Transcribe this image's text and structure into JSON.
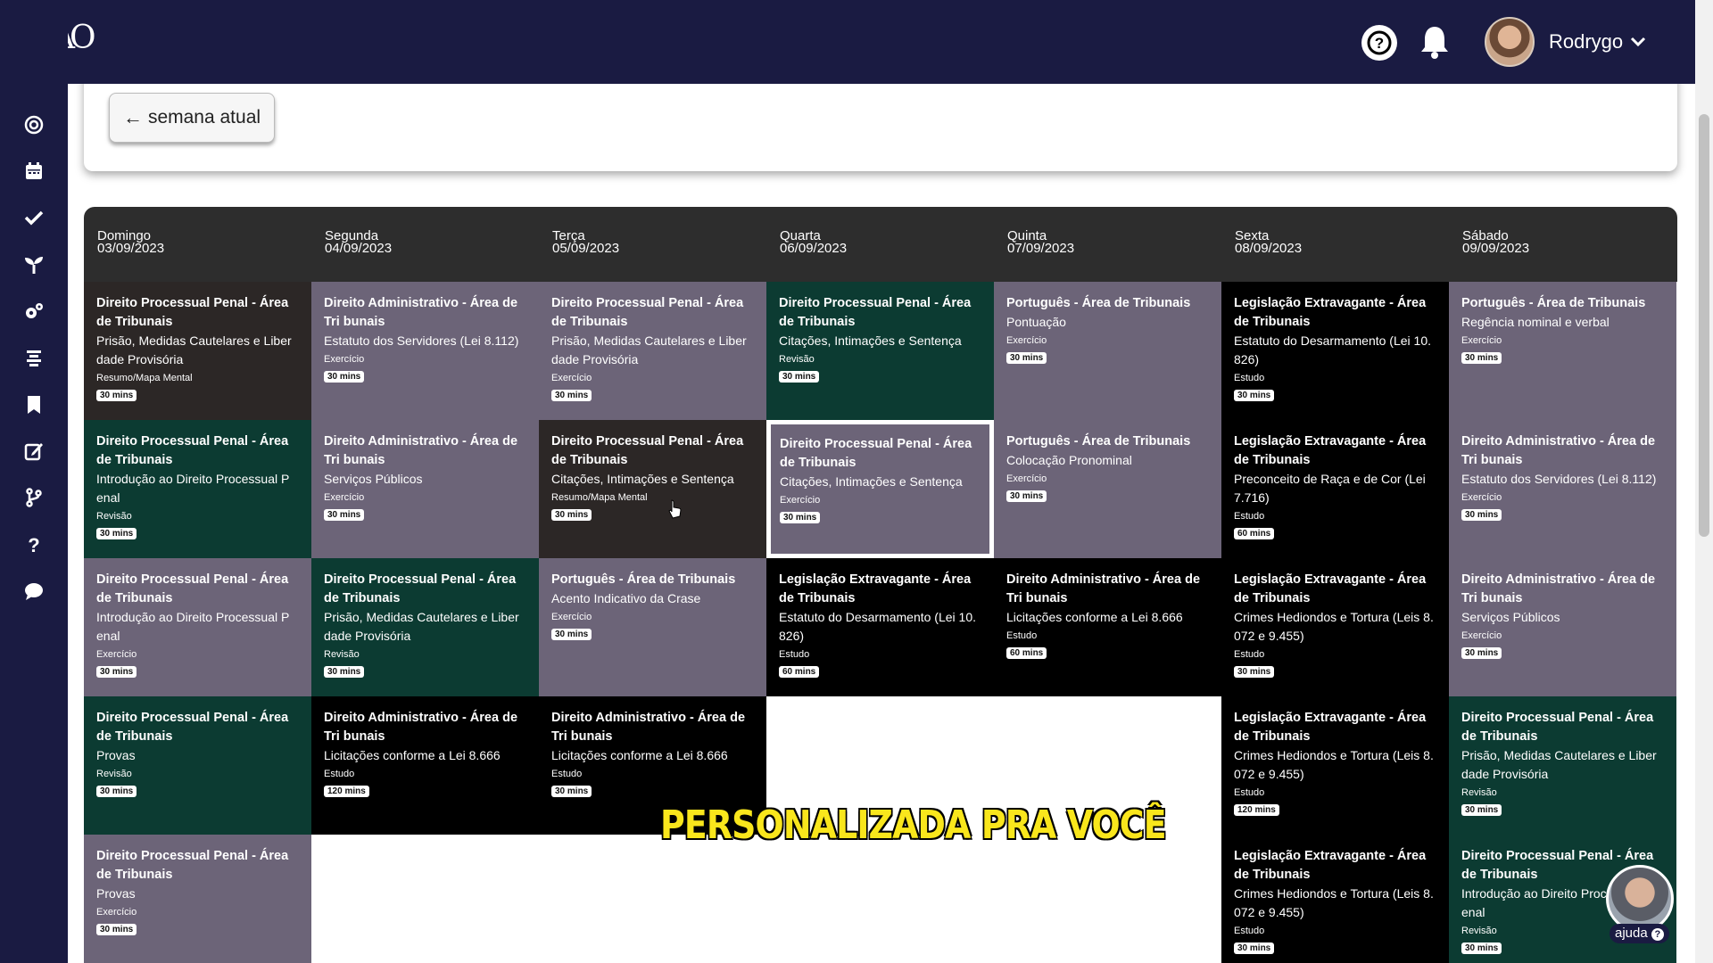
{
  "header": {
    "logo_text": "AO",
    "help_icon": "question-circle-icon",
    "bell_icon": "bell-icon",
    "user_name": "Rodrygo"
  },
  "sidebar": {
    "items": [
      {
        "icon": "target-icon"
      },
      {
        "icon": "calendar-icon"
      },
      {
        "icon": "check-icon"
      },
      {
        "icon": "sprout-icon"
      },
      {
        "icon": "gears-icon"
      },
      {
        "icon": "align-center-icon"
      },
      {
        "icon": "bookmark-icon"
      },
      {
        "icon": "edit-icon"
      },
      {
        "icon": "code-branch-icon"
      },
      {
        "icon": "question-icon"
      },
      {
        "icon": "chat-icon"
      }
    ]
  },
  "week_nav": {
    "back_label": "semana atual"
  },
  "calendar": {
    "days": [
      {
        "name": "Domingo",
        "date": "03/09/2023"
      },
      {
        "name": "Segunda",
        "date": "04/09/2023"
      },
      {
        "name": "Terça",
        "date": "05/09/2023"
      },
      {
        "name": "Quarta",
        "date": "06/09/2023"
      },
      {
        "name": "Quinta",
        "date": "07/09/2023"
      },
      {
        "name": "Sexta",
        "date": "08/09/2023"
      },
      {
        "name": "Sábado",
        "date": "09/09/2023"
      }
    ],
    "columns": [
      [
        {
          "title": "Direito Processual Penal - Área de Tribunais",
          "topic": "Prisão, Medidas Cautelares e Liber dade Provisória",
          "type": "Resumo/Mapa Mental",
          "time": "30 mins",
          "style": "dark"
        },
        {
          "title": "Direito Processual Penal - Área de Tribunais",
          "topic": "Introdução ao Direito Processual P enal",
          "type": "Revisão",
          "time": "30 mins",
          "style": "teal"
        },
        {
          "title": "Direito Processual Penal - Área de Tribunais",
          "topic": "Introdução ao Direito Processual P enal",
          "type": "Exercício",
          "time": "30 mins",
          "style": "mauve"
        },
        {
          "title": "Direito Processual Penal - Área de Tribunais",
          "topic": "Provas",
          "type": "Revisão",
          "time": "30 mins",
          "style": "teal"
        },
        {
          "title": "Direito Processual Penal - Área de Tribunais",
          "topic": "Provas",
          "type": "Exercício",
          "time": "30 mins",
          "style": "mauve"
        }
      ],
      [
        {
          "title": "Direito Administrativo - Área de Tri bunais",
          "topic": "Estatuto dos Servidores (Lei 8.112)",
          "type": "Exercício",
          "time": "30 mins",
          "style": "mauve"
        },
        {
          "title": "Direito Administrativo - Área de Tri bunais",
          "topic": "Serviços Públicos",
          "type": "Exercício",
          "time": "30 mins",
          "style": "mauve"
        },
        {
          "title": "Direito Processual Penal - Área de Tribunais",
          "topic": "Prisão, Medidas Cautelares e Liber dade Provisória",
          "type": "Revisão",
          "time": "30 mins",
          "style": "teal"
        },
        {
          "title": "Direito Administrativo - Área de Tri bunais",
          "topic": "Licitações conforme a Lei 8.666",
          "type": "Estudo",
          "time": "120 mins",
          "style": "black"
        }
      ],
      [
        {
          "title": "Direito Processual Penal - Área de Tribunais",
          "topic": "Prisão, Medidas Cautelares e Liber dade Provisória",
          "type": "Exercício",
          "time": "30 mins",
          "style": "mauve"
        },
        {
          "title": "Direito Processual Penal - Área de Tribunais",
          "topic": "Citações, Intimações e Sentença",
          "type": "Resumo/Mapa Mental",
          "time": "30 mins",
          "style": "dark"
        },
        {
          "title": "Português - Área de Tribunais",
          "topic": "Acento Indicativo da Crase",
          "type": "Exercício",
          "time": "30 mins",
          "style": "mauve"
        },
        {
          "title": "Direito Administrativo - Área de Tri bunais",
          "topic": "Licitações conforme a Lei 8.666",
          "type": "Estudo",
          "time": "30 mins",
          "style": "black"
        }
      ],
      [
        {
          "title": "Direito Processual Penal - Área de Tribunais",
          "topic": "Citações, Intimações e Sentença",
          "type": "Revisão",
          "time": "30 mins",
          "style": "teal"
        },
        {
          "title": "Direito Processual Penal - Área de Tribunais",
          "topic": "Citações, Intimações e Sentença",
          "type": "Exercício",
          "time": "30 mins",
          "style": "mauve",
          "selected": true
        },
        {
          "title": "Legislação Extravagante - Área de Tribunais",
          "topic": "Estatuto do Desarmamento (Lei 10. 826)",
          "type": "Estudo",
          "time": "60 mins",
          "style": "black"
        }
      ],
      [
        {
          "title": "Português - Área de Tribunais",
          "topic": "Pontuação",
          "type": "Exercício",
          "time": "30 mins",
          "style": "mauve"
        },
        {
          "title": "Português - Área de Tribunais",
          "topic": "Colocação Pronominal",
          "type": "Exercício",
          "time": "30 mins",
          "style": "mauve"
        },
        {
          "title": "Direito Administrativo - Área de Tri bunais",
          "topic": "Licitações conforme a Lei 8.666",
          "type": "Estudo",
          "time": "60 mins",
          "style": "black"
        }
      ],
      [
        {
          "title": "Legislação Extravagante - Área de Tribunais",
          "topic": "Estatuto do Desarmamento (Lei 10. 826)",
          "type": "Estudo",
          "time": "30 mins",
          "style": "black"
        },
        {
          "title": "Legislação Extravagante - Área de Tribunais",
          "topic": "Preconceito de Raça e de Cor (Lei 7.716)",
          "type": "Estudo",
          "time": "60 mins",
          "style": "black"
        },
        {
          "title": "Legislação Extravagante - Área de Tribunais",
          "topic": "Crimes Hediondos e Tortura (Leis 8. 072 e 9.455)",
          "type": "Estudo",
          "time": "30 mins",
          "style": "black"
        },
        {
          "title": "Legislação Extravagante - Área de Tribunais",
          "topic": "Crimes Hediondos e Tortura (Leis 8. 072 e 9.455)",
          "type": "Estudo",
          "time": "120 mins",
          "style": "black"
        },
        {
          "title": "Legislação Extravagante - Área de Tribunais",
          "topic": "Crimes Hediondos e Tortura (Leis 8. 072 e 9.455)",
          "type": "Estudo",
          "time": "30 mins",
          "style": "black"
        }
      ],
      [
        {
          "title": "Português - Área de Tribunais",
          "topic": "Regência nominal e verbal",
          "type": "Exercício",
          "time": "30 mins",
          "style": "mauve"
        },
        {
          "title": "Direito Administrativo - Área de Tri bunais",
          "topic": "Estatuto dos Servidores (Lei 8.112)",
          "type": "Exercício",
          "time": "30 mins",
          "style": "mauve"
        },
        {
          "title": "Direito Administrativo - Área de Tri bunais",
          "topic": "Serviços Públicos",
          "type": "Exercício",
          "time": "30 mins",
          "style": "mauve"
        },
        {
          "title": "Direito Processual Penal - Área de Tribunais",
          "topic": "Prisão, Medidas Cautelares e Liber dade Provisória",
          "type": "Revisão",
          "time": "30 mins",
          "style": "teal"
        },
        {
          "title": "Direito Processual Penal - Área de Tribunais",
          "topic": "Introdução ao Direito Processual P enal",
          "type": "Revisão",
          "time": "30 mins",
          "style": "teal"
        }
      ]
    ]
  },
  "overlay": {
    "caption": "PERSONALIZADA PRA VOCÊ"
  },
  "help_widget": {
    "label": "ajuda"
  },
  "colors": {
    "navy": "#1a1b42",
    "mauve": "#6c6478",
    "teal": "#0c3b32",
    "black": "#000000",
    "dark": "#2c2726",
    "caption_yellow": "#f9e61c"
  }
}
